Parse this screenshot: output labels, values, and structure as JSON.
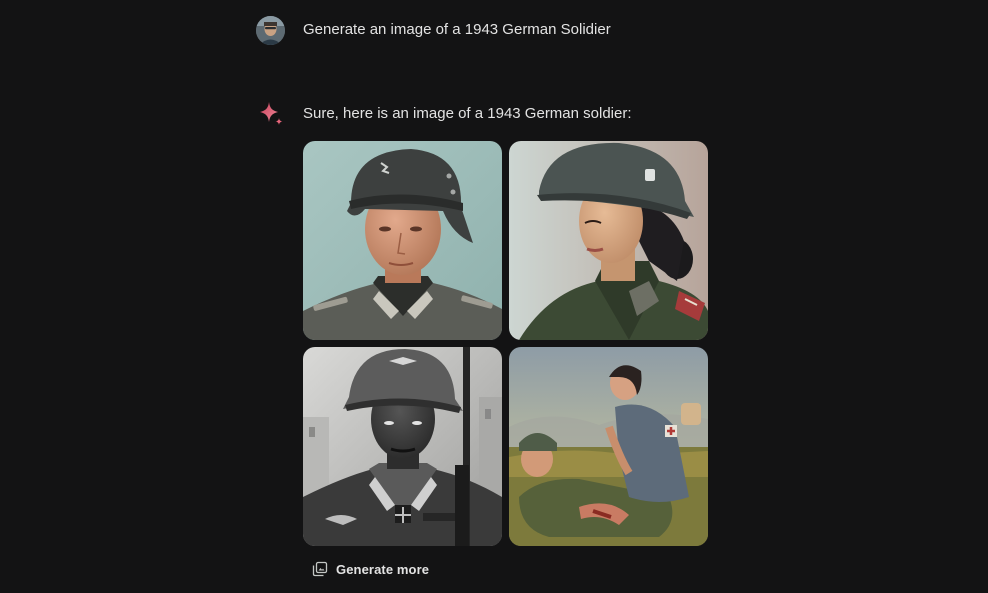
{
  "conversation": {
    "user_turn": {
      "avatar_icon": "user-avatar",
      "prompt": "Generate an image of a 1943 German Solidier"
    },
    "model_turn": {
      "icon": "gemini-sparkle-icon",
      "response": "Sure, here is an image of a 1943 German soldier:",
      "images": [
        {
          "icon": "generated-image-1"
        },
        {
          "icon": "generated-image-2"
        },
        {
          "icon": "generated-image-3"
        },
        {
          "icon": "generated-image-4"
        }
      ],
      "generate_more_label": "Generate more",
      "generate_more_icon": "image-stack-icon"
    }
  },
  "colors": {
    "background": "#131314",
    "text": "#e3e3e3",
    "sparkle_start": "#e0475e",
    "sparkle_end": "#f08a9a"
  }
}
